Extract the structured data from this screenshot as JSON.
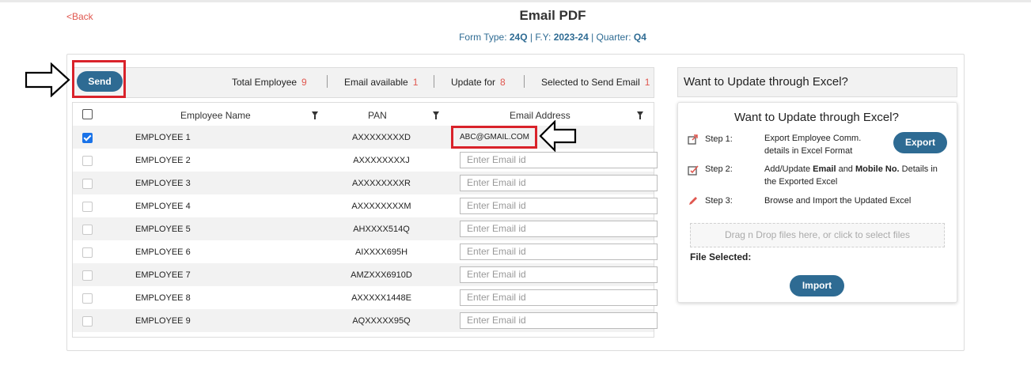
{
  "header": {
    "back_label": "<Back",
    "title": "Email PDF",
    "form_type_label": "Form Type: ",
    "form_type": "24Q",
    "fy_label": " | F.Y: ",
    "fy": "2023-24",
    "quarter_label": " | Quarter: ",
    "quarter": "Q4"
  },
  "toolbar": {
    "send_label": "Send",
    "total_employee_label": "Total Employee",
    "total_employee": "9",
    "email_available_label": "Email available",
    "email_available": "1",
    "update_for_label": "Update for",
    "update_for": "8",
    "selected_label": "Selected to Send Email",
    "selected": "1"
  },
  "table": {
    "columns": [
      "Employee Name",
      "PAN",
      "Email Address"
    ],
    "email_placeholder": "Enter Email id",
    "rows": [
      {
        "name": "EMPLOYEE 1",
        "pan": "AXXXXXXXXD",
        "email": "ABC@GMAIL.COM",
        "checked": true
      },
      {
        "name": "EMPLOYEE 2",
        "pan": "AXXXXXXXXJ",
        "email": "",
        "checked": false
      },
      {
        "name": "EMPLOYEE 3",
        "pan": "AXXXXXXXXR",
        "email": "",
        "checked": false
      },
      {
        "name": "EMPLOYEE 4",
        "pan": "AXXXXXXXXM",
        "email": "",
        "checked": false
      },
      {
        "name": "EMPLOYEE 5",
        "pan": "AHXXXX514Q",
        "email": "",
        "checked": false
      },
      {
        "name": "EMPLOYEE 6",
        "pan": "AIXXXX695H",
        "email": "",
        "checked": false
      },
      {
        "name": "EMPLOYEE 7",
        "pan": "AMZXXX6910D",
        "email": "",
        "checked": false
      },
      {
        "name": "EMPLOYEE 8",
        "pan": "AXXXXX1448E",
        "email": "",
        "checked": false
      },
      {
        "name": "EMPLOYEE 9",
        "pan": "AQXXXXX95Q",
        "email": "",
        "checked": false
      }
    ]
  },
  "excel_panel": {
    "heading": "Want to Update through Excel?",
    "card_title": "Want to Update through Excel?",
    "steps": [
      {
        "label": "Step 1:",
        "desc_line1": "Export Employee Comm.",
        "desc_line2": "details in Excel Format",
        "icon": "export-icon"
      },
      {
        "label": "Step 2:",
        "desc_pre": "Add/Update ",
        "desc_bold1": "Email",
        "desc_mid": " and ",
        "desc_bold2": "Mobile No.",
        "desc_post": " Details in",
        "desc_line2": "the Exported Excel",
        "icon": "edit-checkbox-icon"
      },
      {
        "label": "Step 3:",
        "desc_line1": "Browse and Import the Updated Excel",
        "icon": "pencil-icon"
      }
    ],
    "export_label": "Export",
    "dropzone_text": "Drag n Drop files here, or click to select files",
    "file_selected_label": "File Selected:",
    "import_label": "Import"
  },
  "colors": {
    "primary": "#2e6b93",
    "accent_red": "#e0574f",
    "highlight_box": "#d9222a",
    "checkbox_checked": "#1a73e8"
  }
}
